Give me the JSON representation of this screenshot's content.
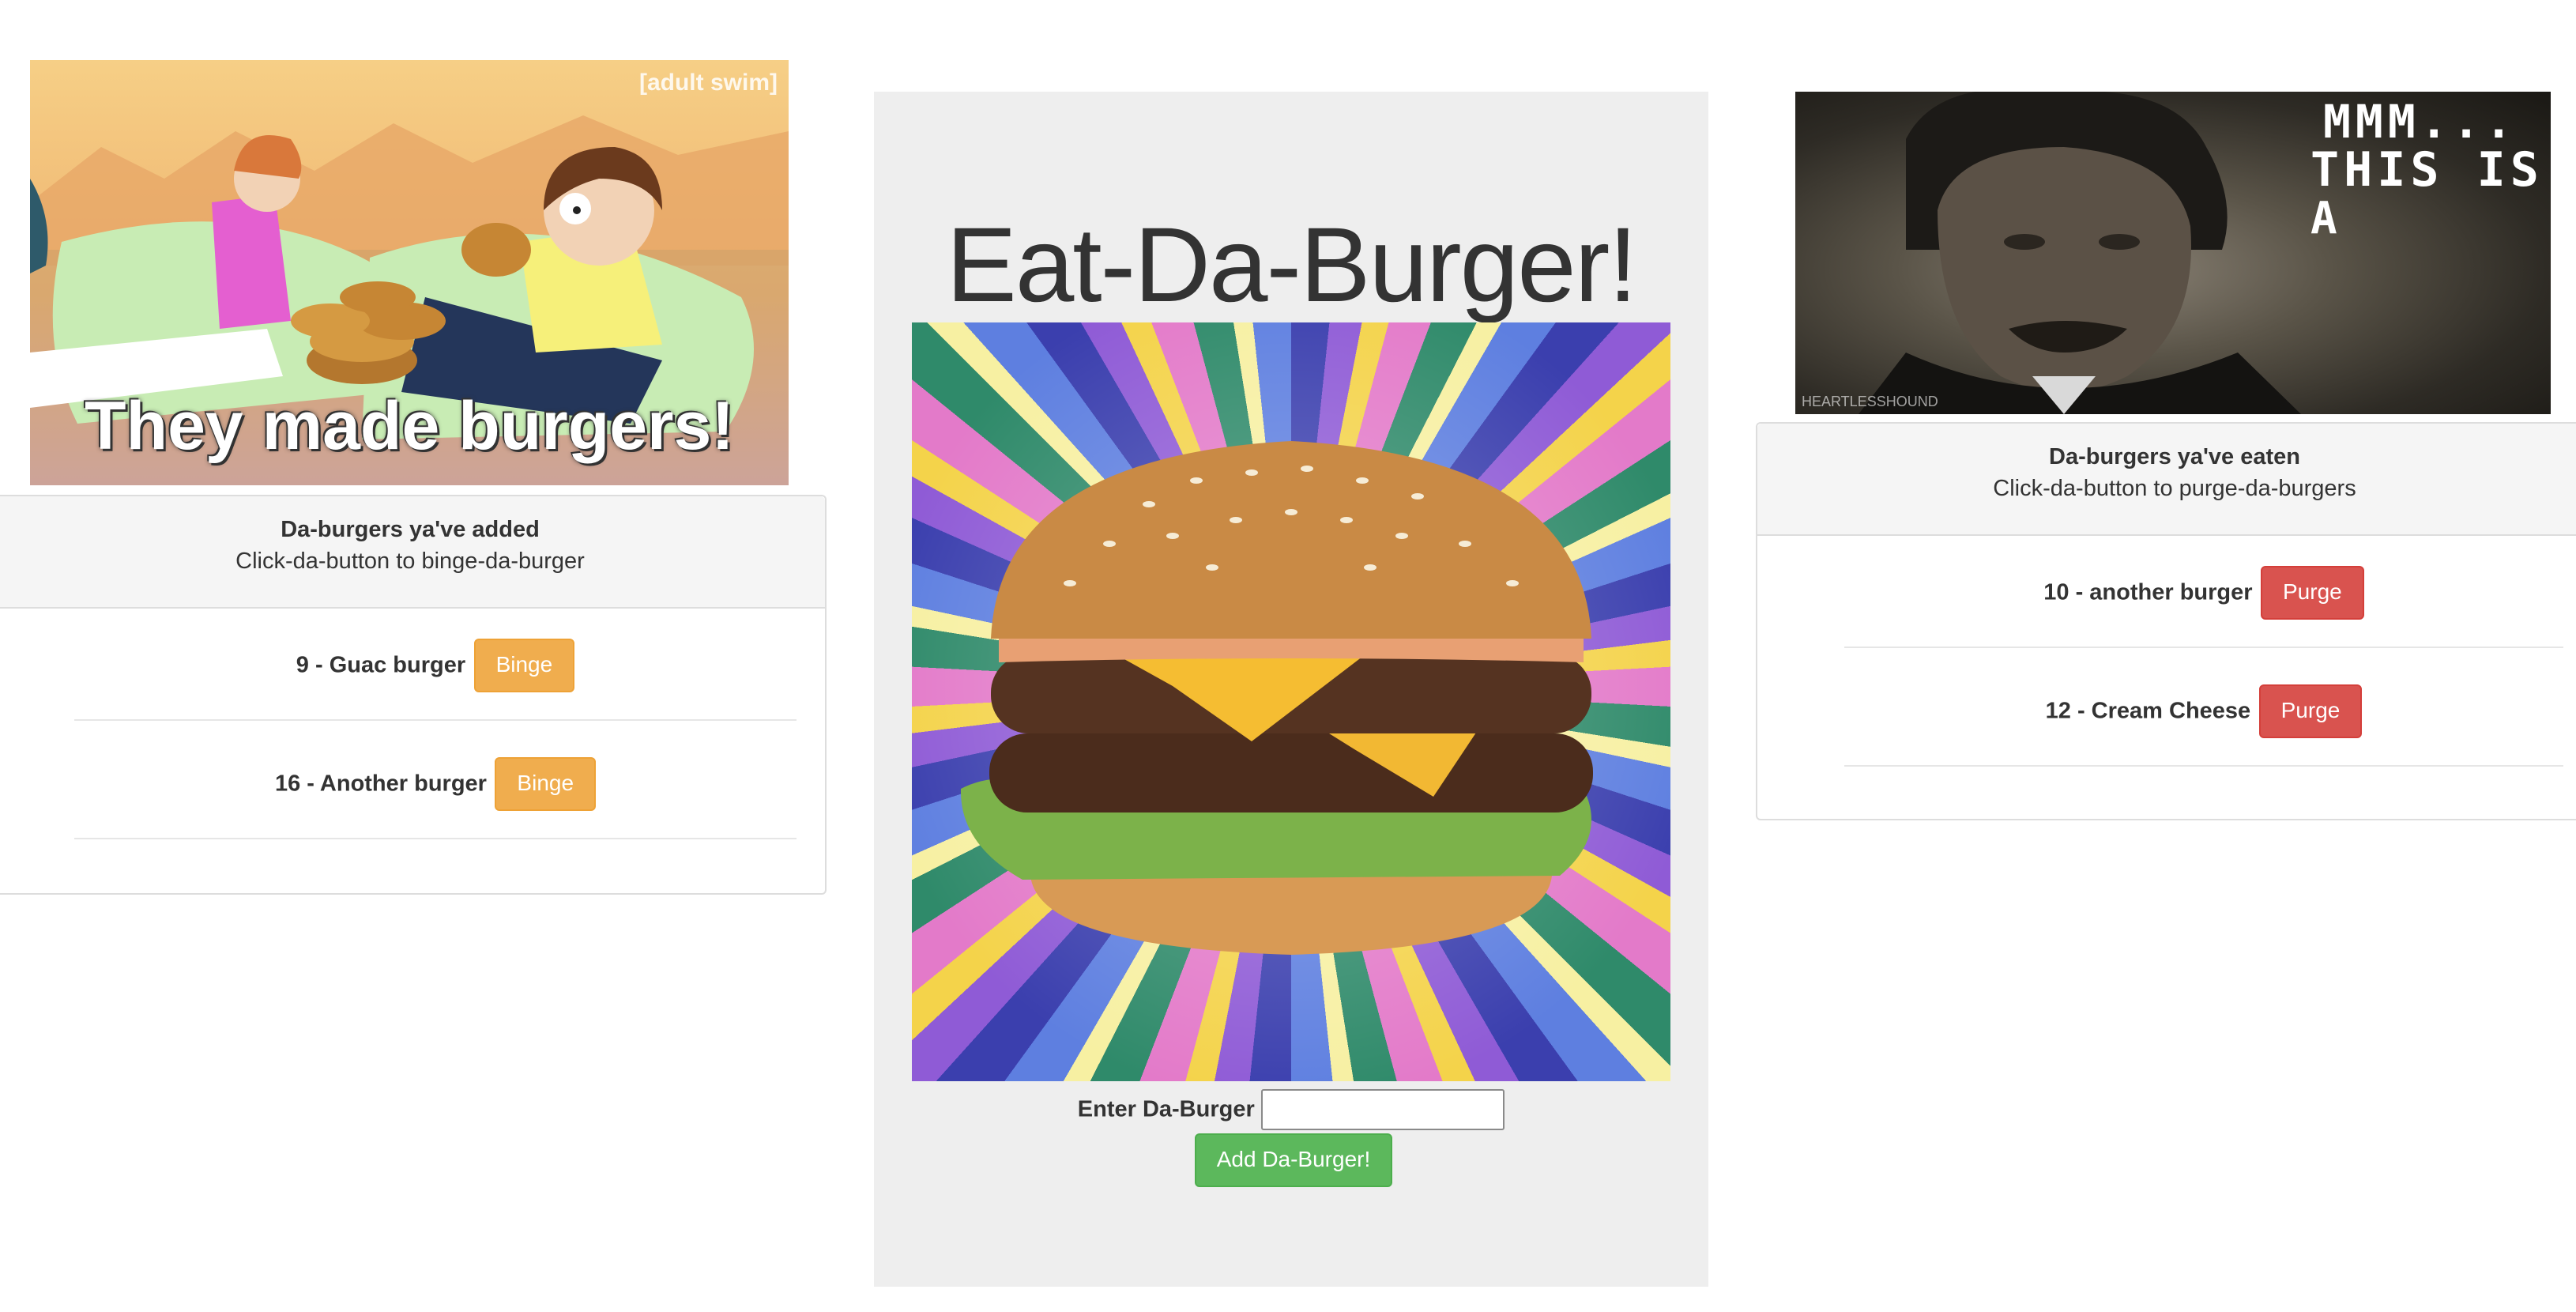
{
  "left": {
    "gif": {
      "caption": "They made burgers!",
      "watermark": "[adult swim]"
    },
    "panel": {
      "title": "Da-burgers ya've added",
      "subtitle": "Click-da-button to binge-da-burger",
      "items": [
        {
          "label": "9 - Guac burger",
          "button": "Binge"
        },
        {
          "label": "16 - Another burger",
          "button": "Binge"
        }
      ]
    }
  },
  "center": {
    "title": "Eat-Da-Burger!",
    "form": {
      "label": "Enter Da-Burger",
      "input_value": "",
      "submit_label": "Add Da-Burger!"
    }
  },
  "right": {
    "gif": {
      "caption_line1": "MMM...",
      "caption_line2": "THIS IS",
      "caption_line3": "A",
      "watermark": "HEARTLESSHOUND"
    },
    "panel": {
      "title": "Da-burgers ya've eaten",
      "subtitle": "Click-da-button to purge-da-burgers",
      "items": [
        {
          "label": "10 - another burger",
          "button": "Purge"
        },
        {
          "label": "12 - Cream Cheese",
          "button": "Purge"
        }
      ]
    }
  },
  "colors": {
    "binge": "#f0ad4e",
    "purge": "#d9534f",
    "add": "#5cb85c",
    "well": "#eeeeee",
    "panel_heading": "#f5f5f5"
  }
}
